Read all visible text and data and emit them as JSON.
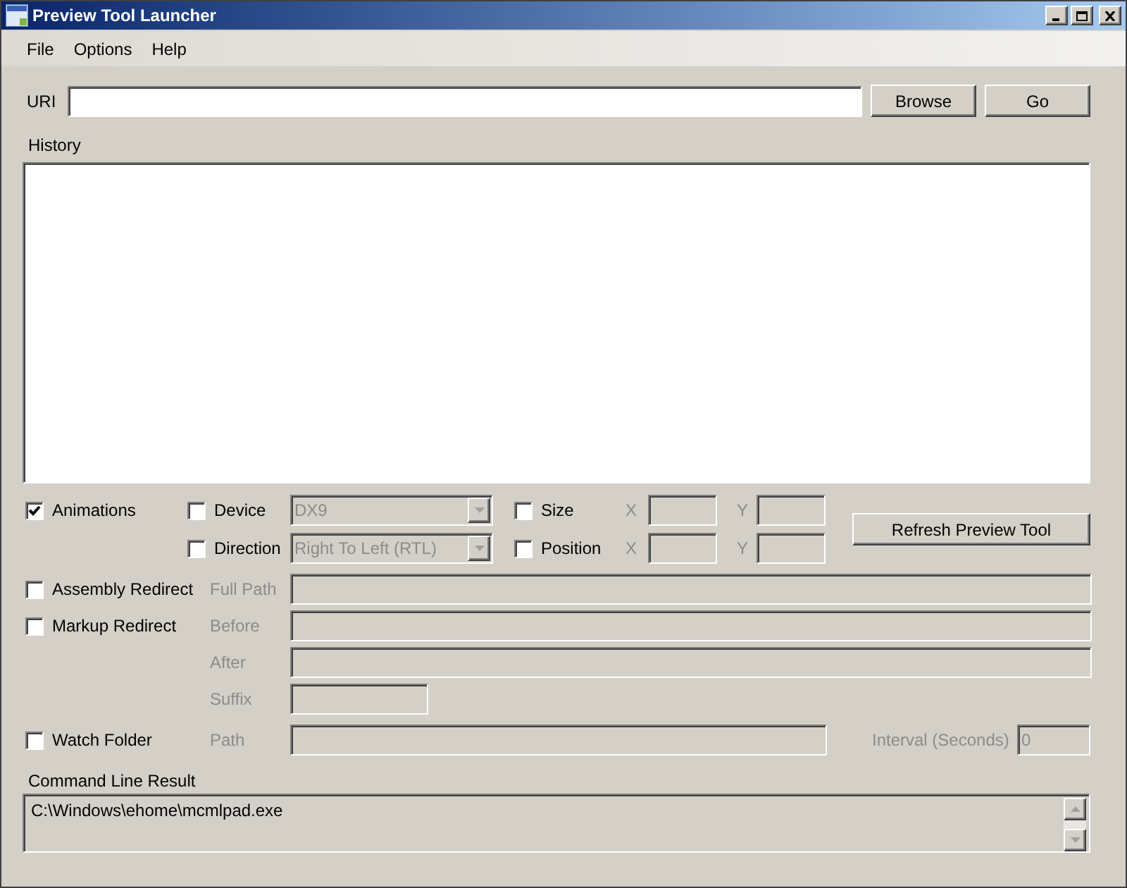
{
  "window": {
    "title": "Preview Tool Launcher"
  },
  "menu": [
    {
      "label": "File"
    },
    {
      "label": "Options"
    },
    {
      "label": "Help"
    }
  ],
  "uri": {
    "label": "URI"
  },
  "buttons": [
    {
      "label": "Browse"
    },
    {
      "label": "Go"
    }
  ],
  "history": {
    "label": "History"
  },
  "animations": {
    "label": "Animations",
    "checked": true
  },
  "device": {
    "label": "Device",
    "checked": false,
    "value": "DX9",
    "disabled": true
  },
  "direction": {
    "label": "Direction",
    "checked": false,
    "value": "Right To Left (RTL)",
    "disabled": true
  },
  "size": {
    "label": "Size",
    "checked": false,
    "x_label": "X",
    "y_label": "Y",
    "disabled": true
  },
  "position": {
    "label": "Position",
    "checked": false,
    "x_label": "X",
    "y_label": "Y",
    "disabled": true
  },
  "refresh_button": {
    "label": "Refresh Preview Tool"
  },
  "assembly_redirect": {
    "label": "Assembly Redirect",
    "checked": false,
    "disabled": true,
    "fields": [
      {
        "label": "Full Path",
        "kind": "wide"
      }
    ]
  },
  "markup_redirect": {
    "label": "Markup Redirect",
    "checked": false,
    "disabled": true,
    "fields": [
      {
        "label": "Before",
        "kind": "wide"
      },
      {
        "label": "After",
        "kind": "wide"
      },
      {
        "label": "Suffix",
        "kind": "short"
      }
    ]
  },
  "watch_folder": {
    "label": "Watch Folder",
    "checked": false,
    "disabled": true,
    "path_label": "Path",
    "interval_label": "Interval (Seconds)",
    "interval_value": "0"
  },
  "command_line_result": {
    "label": "Command Line Result",
    "value": "C:\\Windows\\ehome\\mcmlpad.exe"
  }
}
